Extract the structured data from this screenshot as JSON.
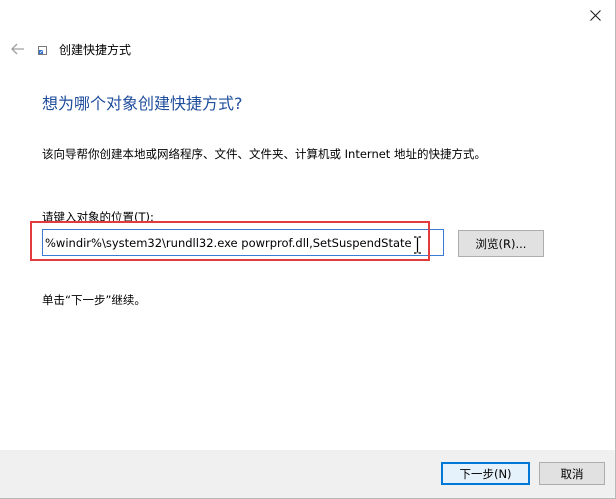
{
  "window": {
    "title": "创建快捷方式",
    "close_icon": "close-icon",
    "back_icon": "back-arrow-icon",
    "app_icon": "shortcut-icon"
  },
  "content": {
    "heading": "想为哪个对象创建快捷方式?",
    "description": "该向导帮你创建本地或网络程序、文件、文件夹、计算机或 Internet 地址的快捷方式。",
    "location_label": "请键入对象的位置(T):",
    "location_value": "%windir%\\system32\\rundll32.exe powrprof.dll,SetSuspendState",
    "browse_label": "浏览(R)...",
    "hint": "单击“下一步”继续。"
  },
  "footer": {
    "next_label": "下一步(N)",
    "cancel_label": "取消"
  },
  "colors": {
    "heading": "#1f4e9c",
    "input_border": "#3b7bd4",
    "highlight": "#e33b3b",
    "footer_bg": "#f0f0f0",
    "primary_border": "#0078d7"
  }
}
